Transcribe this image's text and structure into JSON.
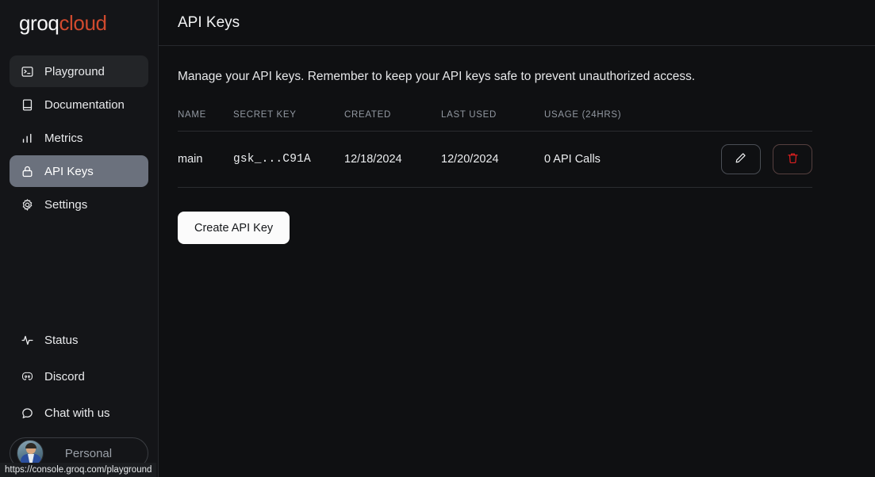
{
  "brand": {
    "part1": "groq",
    "part2": "cloud",
    "accent": "#d04a2e"
  },
  "sidebar": {
    "top_items": [
      {
        "label": "Playground",
        "icon": "terminal-icon"
      },
      {
        "label": "Documentation",
        "icon": "book-icon"
      },
      {
        "label": "Metrics",
        "icon": "bar-chart-icon"
      },
      {
        "label": "API Keys",
        "icon": "lock-icon"
      },
      {
        "label": "Settings",
        "icon": "gear-icon"
      }
    ],
    "bottom_items": [
      {
        "label": "Status",
        "icon": "activity-icon"
      },
      {
        "label": "Discord",
        "icon": "discord-icon"
      },
      {
        "label": "Chat with us",
        "icon": "chat-bubble-icon"
      }
    ],
    "account": {
      "label": "Personal"
    }
  },
  "header": {
    "title": "API Keys"
  },
  "main": {
    "description": "Manage your API keys. Remember to keep your API keys safe to prevent unauthorized access.",
    "table": {
      "columns": [
        "NAME",
        "SECRET KEY",
        "CREATED",
        "LAST USED",
        "USAGE (24HRS)"
      ],
      "rows": [
        {
          "name": "main",
          "secret_key": "gsk_...C91A",
          "created": "12/18/2024",
          "last_used": "12/20/2024",
          "usage": "0 API Calls"
        }
      ]
    },
    "create_button": "Create API Key"
  },
  "statusbar": {
    "url": "https://console.groq.com/playground"
  }
}
